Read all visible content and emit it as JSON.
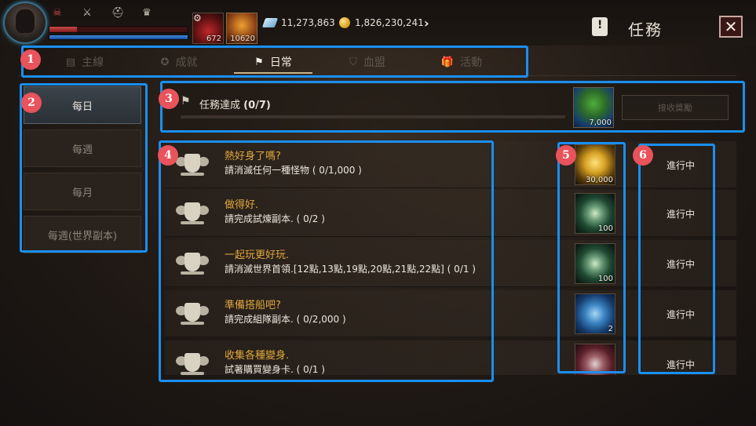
{
  "topbar": {
    "status_icons": [
      "skull-icon",
      "sword-icon",
      "helmet-icon",
      "trophy-icon"
    ],
    "hp_percent": 20,
    "mp_percent": 100,
    "potion_qty": "672",
    "scroll_qty": "10620",
    "diamonds": "11,273,863",
    "gold": "1,826,230,241",
    "title": "任務",
    "close_label": "✕"
  },
  "tabs": [
    {
      "label": "主線",
      "icon": "list-icon"
    },
    {
      "label": "成就",
      "icon": "medal-icon"
    },
    {
      "label": "日常",
      "icon": "flag-icon"
    },
    {
      "label": "血盟",
      "icon": "shield-icon"
    },
    {
      "label": "活動",
      "icon": "gift-icon"
    }
  ],
  "sidebar": {
    "items": [
      {
        "label": "每日"
      },
      {
        "label": "每週"
      },
      {
        "label": "每月"
      },
      {
        "label": "每週(世界副本)"
      }
    ]
  },
  "progress": {
    "label": "任務達成",
    "count": "(0/7)",
    "percent": 0,
    "reward_qty": "7,000",
    "claim_label": "接收獎勵"
  },
  "quests": [
    {
      "title": "熱好身了嗎?",
      "desc": "請消滅任何一種怪物 ( 0/1,000 )",
      "reward_qty": "30,000",
      "reward_type": "gold",
      "status": "進行中"
    },
    {
      "title": "做得好.",
      "desc": "請完成試煉副本. ( 0/2 )",
      "reward_qty": "100",
      "reward_type": "green",
      "status": "進行中"
    },
    {
      "title": "一起玩更好玩.",
      "desc": "請消滅世界首領.[12點,13點,19點,20點,21點,22點] ( 0/1 )",
      "reward_qty": "100",
      "reward_type": "green",
      "status": "進行中"
    },
    {
      "title": "準備搭船吧?",
      "desc": "請完成組隊副本. ( 0/2,000 )",
      "reward_qty": "2",
      "reward_type": "blue",
      "status": "進行中"
    },
    {
      "title": "收集各種變身.",
      "desc": "試著購買變身卡. ( 0/1 )",
      "reward_qty": "",
      "reward_type": "red",
      "status": "進行中"
    }
  ],
  "annotations": [
    "1",
    "2",
    "3",
    "4",
    "5",
    "6"
  ],
  "colors": {
    "annotation": "#1a8ff0",
    "badge": "#e9535c",
    "quest_title": "#e0a83e"
  }
}
